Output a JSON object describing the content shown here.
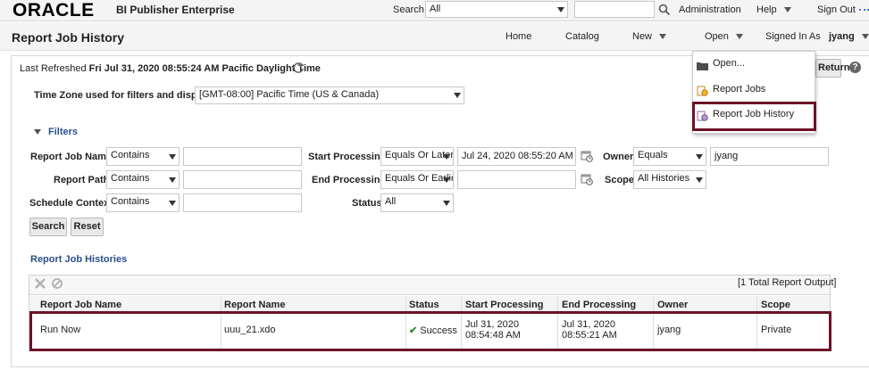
{
  "header": {
    "brand": "ORACLE",
    "product": "BI Publisher Enterprise",
    "search_label": "Search",
    "search_scope": "All",
    "search_query": "",
    "administration": "Administration",
    "help": "Help",
    "sign_out": "Sign Out"
  },
  "nav": {
    "page_title": "Report Job History",
    "home": "Home",
    "catalog": "Catalog",
    "new": "New",
    "open": "Open",
    "signed_in_as_label": "Signed In As",
    "username": "jyang"
  },
  "refresh": {
    "label": "Last Refreshed",
    "value": "Fri Jul 31, 2020 08:55:24 AM Pacific Daylight Time",
    "return_label": "Return"
  },
  "timezone": {
    "label": "Time Zone used for filters and display",
    "value": "[GMT-08:00] Pacific Time (US & Canada)"
  },
  "filters": {
    "section_label": "Filters",
    "report_job_name": {
      "label": "Report Job Name",
      "op": "Contains",
      "value": ""
    },
    "report_path": {
      "label": "Report Path",
      "op": "Contains",
      "value": ""
    },
    "schedule_context": {
      "label": "Schedule Context",
      "op": "Contains",
      "value": ""
    },
    "start_processing": {
      "label": "Start Processing",
      "op": "Equals Or Later",
      "value": "Jul 24, 2020 08:55:20 AM"
    },
    "end_processing": {
      "label": "End Processing",
      "op": "Equals Or Earlier",
      "value": ""
    },
    "status": {
      "label": "Status",
      "value": "All"
    },
    "owner": {
      "label": "Owner",
      "op": "Equals",
      "value": "jyang"
    },
    "scope": {
      "label": "Scope",
      "value": "All Histories"
    },
    "search_button": "Search",
    "reset_button": "Reset"
  },
  "histories": {
    "section_label": "Report Job Histories",
    "total_output": "[1 Total Report Output]",
    "columns": [
      "Report Job Name",
      "Report Name",
      "Status",
      "Start Processing",
      "End Processing",
      "Owner",
      "Scope"
    ],
    "rows": [
      {
        "report_job_name": "Run Now",
        "report_name": "uuu_21.xdo",
        "status": "Success",
        "start_processing": "Jul 31, 2020 08:54:48 AM",
        "end_processing": "Jul 31, 2020 08:55:21 AM",
        "owner": "jyang",
        "scope": "Private"
      }
    ]
  },
  "open_menu": {
    "items": [
      "Open...",
      "Report Jobs",
      "Report Job History"
    ],
    "highlight_color": "#6b1226"
  },
  "colors": {
    "link_blue": "#2a4f8a",
    "success_green": "#2e8b2e",
    "highlight_border": "#6b1226",
    "oracle_red": "#000000"
  }
}
